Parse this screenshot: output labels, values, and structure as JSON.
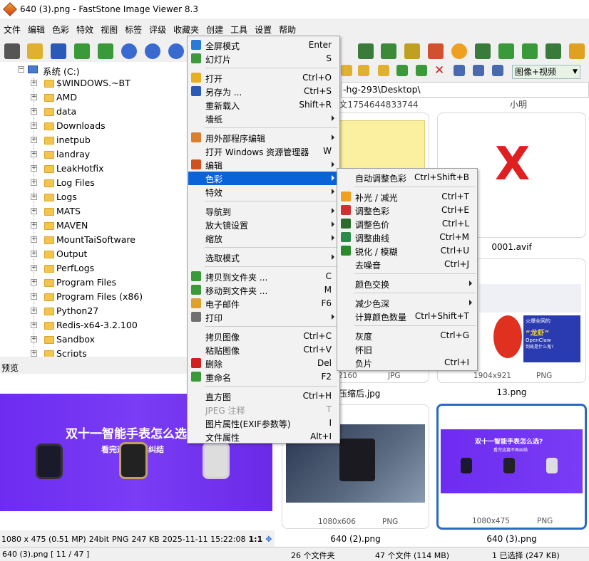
{
  "window": {
    "title": "640 (3).png  -  FastStone Image Viewer 8.3"
  },
  "menubar": [
    "文件",
    "编辑",
    "色彩",
    "特效",
    "视图",
    "标签",
    "评级",
    "收藏夹",
    "创建",
    "工具",
    "设置",
    "帮助"
  ],
  "tree": {
    "root": "系统 (C:)",
    "folders": [
      "$WINDOWS.~BT",
      "AMD",
      "data",
      "Downloads",
      "inetpub",
      "landray",
      "LeakHotfix",
      "Log Files",
      "Logs",
      "MATS",
      "MAVEN",
      "MountTaiSoftware",
      "Output",
      "PerfLogs",
      "Program Files",
      "Program Files (x86)",
      "Python27",
      "Redis-x64-3.2.100",
      "Sandbox",
      "Scripts"
    ]
  },
  "preview": {
    "label": "预览",
    "banner_title": "双十一智能手表怎么选",
    "banner_sub": "看完这篇不再纠结"
  },
  "image_info": {
    "dims": "1080 x 475 (0.51 MP)",
    "bits": "24bit",
    "format": "PNG",
    "size": "247 KB",
    "date": "2025-11-11 15:22:08",
    "zoom": "1:1"
  },
  "statusbar": {
    "file": "640 (3).png [ 11 / 47 ]",
    "folders": "26 个文件夹",
    "files": "47 个文件 (114 MB)",
    "selected": "1 已选择 (247 KB)"
  },
  "toolbar": {
    "view_mode": "图像+视频"
  },
  "path": "-hg-293\\Desktop\\",
  "gallery": {
    "top_captions": [
      "图文1754644833744",
      "小明"
    ],
    "items": [
      {
        "caption": "",
        "dims": "",
        "fmt": ""
      },
      {
        "caption": "0001.avif",
        "dims": "",
        "fmt": ""
      },
      {
        "caption": "压缩后.jpg",
        "dims": "2160",
        "fmt": "JPG"
      },
      {
        "caption": "13.png",
        "dims": "1904x921",
        "fmt": "PNG"
      },
      {
        "caption": "640 (2).png",
        "dims": "1080x606",
        "fmt": "PNG"
      },
      {
        "caption": "640 (3).png",
        "dims": "1080x475",
        "fmt": "PNG"
      }
    ],
    "thumb_banner_title": "双十一智能手表怎么选?",
    "thumb_banner_sub": "看完这篇不再纠结",
    "lobster_title": "火爆全网的",
    "lobster_name": "“龙虾”",
    "lobster_brand": "OpenClaw",
    "lobster_sub": "到底是什么鬼?"
  },
  "context_menu": [
    {
      "label": "全屏模式",
      "shortcut": "Enter",
      "icon": "fullscreen-icon",
      "color": "#2a7ad8"
    },
    {
      "label": "幻灯片",
      "shortcut": "S",
      "icon": "slideshow-icon",
      "color": "#3c9a3c"
    },
    {
      "sep": true
    },
    {
      "label": "打开",
      "shortcut": "Ctrl+O",
      "icon": "open-icon",
      "color": "#e8b020"
    },
    {
      "label": "另存为 ...",
      "shortcut": "Ctrl+S",
      "icon": "save-icon",
      "color": "#2a5ab8"
    },
    {
      "label": "重新载入",
      "shortcut": "Shift+R"
    },
    {
      "label": "墙纸",
      "submenu": true
    },
    {
      "sep": true
    },
    {
      "label": "用外部程序编辑",
      "submenu": true,
      "icon": "palette-icon",
      "color": "#d88030"
    },
    {
      "label": "打开 Windows 资源管理器",
      "shortcut": "W"
    },
    {
      "label": "编辑",
      "submenu": true,
      "icon": "edit-icon",
      "color": "#d05020"
    },
    {
      "label": "色彩",
      "submenu": true,
      "selected": true
    },
    {
      "label": "特效",
      "submenu": true
    },
    {
      "sep": true
    },
    {
      "label": "导航到",
      "submenu": true
    },
    {
      "label": "放大镜设置",
      "submenu": true
    },
    {
      "label": "缩放",
      "submenu": true
    },
    {
      "sep": true
    },
    {
      "label": "选取模式",
      "submenu": true
    },
    {
      "sep": true
    },
    {
      "label": "拷贝到文件夹 ...",
      "shortcut": "C",
      "icon": "copy-folder-icon",
      "color": "#3a9a3a"
    },
    {
      "label": "移动到文件夹 ...",
      "shortcut": "M",
      "icon": "move-folder-icon",
      "color": "#3a9a3a"
    },
    {
      "label": "电子邮件",
      "shortcut": "F6",
      "icon": "email-icon",
      "color": "#e0a030"
    },
    {
      "label": "打印",
      "submenu": true,
      "icon": "print-icon",
      "color": "#707070"
    },
    {
      "sep": true
    },
    {
      "label": "拷贝图像",
      "shortcut": "Ctrl+C"
    },
    {
      "label": "粘贴图像",
      "shortcut": "Ctrl+V"
    },
    {
      "label": "删除",
      "shortcut": "Del",
      "icon": "delete-icon",
      "color": "#d02020"
    },
    {
      "label": "重命名",
      "shortcut": "F2",
      "icon": "rename-icon",
      "color": "#3a9a3a"
    },
    {
      "sep": true
    },
    {
      "label": "直方图",
      "shortcut": "Ctrl+H"
    },
    {
      "label": "JPEG 注释",
      "shortcut": "T",
      "disabled": true
    },
    {
      "label": "图片属性(EXIF参数等)",
      "shortcut": "I"
    },
    {
      "label": "文件属性",
      "shortcut": "Alt+I"
    }
  ],
  "color_submenu": [
    {
      "label": "自动调整色彩",
      "shortcut": "Ctrl+Shift+B"
    },
    {
      "sep": true
    },
    {
      "label": "补光 / 减光",
      "shortcut": "Ctrl+T",
      "icon": "sun-icon",
      "color": "#f0a020"
    },
    {
      "label": "调整色彩",
      "shortcut": "Ctrl+E",
      "icon": "rgb-icon",
      "color": "#d03030"
    },
    {
      "label": "调整色价",
      "shortcut": "Ctrl+L",
      "icon": "levels-icon",
      "color": "#2a6a2a"
    },
    {
      "label": "调整曲线",
      "shortcut": "Ctrl+M",
      "icon": "curves-icon",
      "color": "#2a8a4a"
    },
    {
      "label": "锐化 / 模糊",
      "shortcut": "Ctrl+U",
      "icon": "sharpen-icon",
      "color": "#2a8a2a"
    },
    {
      "label": "去噪音",
      "shortcut": "Ctrl+J"
    },
    {
      "sep": true
    },
    {
      "label": "颜色交换",
      "submenu": true
    },
    {
      "sep": true
    },
    {
      "label": "减少色深",
      "submenu": true
    },
    {
      "label": "计算颜色数量",
      "shortcut": "Ctrl+Shift+T"
    },
    {
      "sep": true
    },
    {
      "label": "灰度",
      "shortcut": "Ctrl+G"
    },
    {
      "label": "怀旧",
      "shortcut": ""
    },
    {
      "label": "负片",
      "shortcut": "Ctrl+I"
    }
  ]
}
